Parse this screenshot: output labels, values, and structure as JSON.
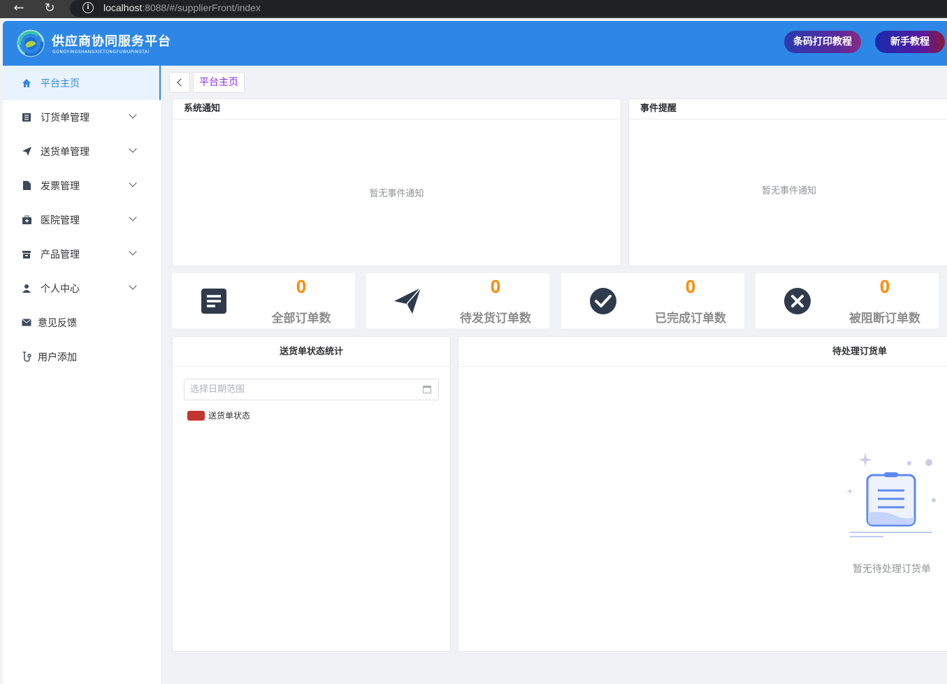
{
  "browser": {
    "url_host": "localhost",
    "url_rest": ":8088/#/supplierFront/index"
  },
  "header": {
    "title": "供应商协同服务平台",
    "subtitle": "GONGYINGSHANGXIETONGFUWUPINGTAI",
    "btn_barcode_tutorial": "条码打印教程",
    "btn_beginner_tutorial": "新手教程",
    "brand_color": "#2d87e6"
  },
  "sidebar": {
    "items": [
      {
        "label": "平台主页",
        "icon": "home-icon",
        "active": true
      },
      {
        "label": "订货单管理",
        "icon": "list-icon",
        "expandable": true
      },
      {
        "label": "送货单管理",
        "icon": "send-icon",
        "expandable": true
      },
      {
        "label": "发票管理",
        "icon": "file-icon",
        "expandable": true
      },
      {
        "label": "医院管理",
        "icon": "medkit-icon",
        "expandable": true
      },
      {
        "label": "产品管理",
        "icon": "box-icon",
        "expandable": true
      },
      {
        "label": "个人中心",
        "icon": "user-icon",
        "expandable": true
      },
      {
        "label": "意见反馈",
        "icon": "mail-icon"
      },
      {
        "label": "用户添加",
        "icon": "user-add-icon"
      }
    ]
  },
  "tabs": {
    "current": "平台主页"
  },
  "notices": {
    "system_title": "系统通知",
    "system_empty": "暂无事件通知",
    "event_title": "事件提醒",
    "event_empty": "暂无事件通知"
  },
  "stats": [
    {
      "value": "0",
      "label": "全部订单数",
      "icon": "document-icon"
    },
    {
      "value": "0",
      "label": "待发货订单数",
      "icon": "paper-plane-icon"
    },
    {
      "value": "0",
      "label": "已完成订单数",
      "icon": "check-circle-icon"
    },
    {
      "value": "0",
      "label": "被阻断订单数",
      "icon": "x-circle-icon"
    }
  ],
  "delivery_stats": {
    "title": "送货单状态统计",
    "date_placeholder": "选择日期范围",
    "legend_label": "送货单状态",
    "legend_color": "#c23531"
  },
  "pending_orders": {
    "title": "待处理订货单",
    "empty_text": "暂无待处理订货单"
  }
}
